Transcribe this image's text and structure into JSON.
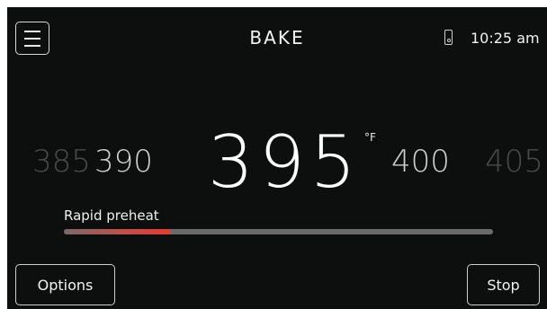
{
  "header": {
    "title": "BAKE",
    "menu_icon": "hamburger-menu-icon",
    "remote_icon": "phone-icon",
    "time": "10:25 am"
  },
  "temperature": {
    "far_left": "385",
    "left": "390",
    "current": "395",
    "unit": "°F",
    "right": "400",
    "far_right": "405"
  },
  "preheat": {
    "label": "Rapid preheat",
    "progress_fraction": 0.25,
    "fill_color": "#e53b2f"
  },
  "footer": {
    "options_label": "Options",
    "stop_label": "Stop"
  }
}
